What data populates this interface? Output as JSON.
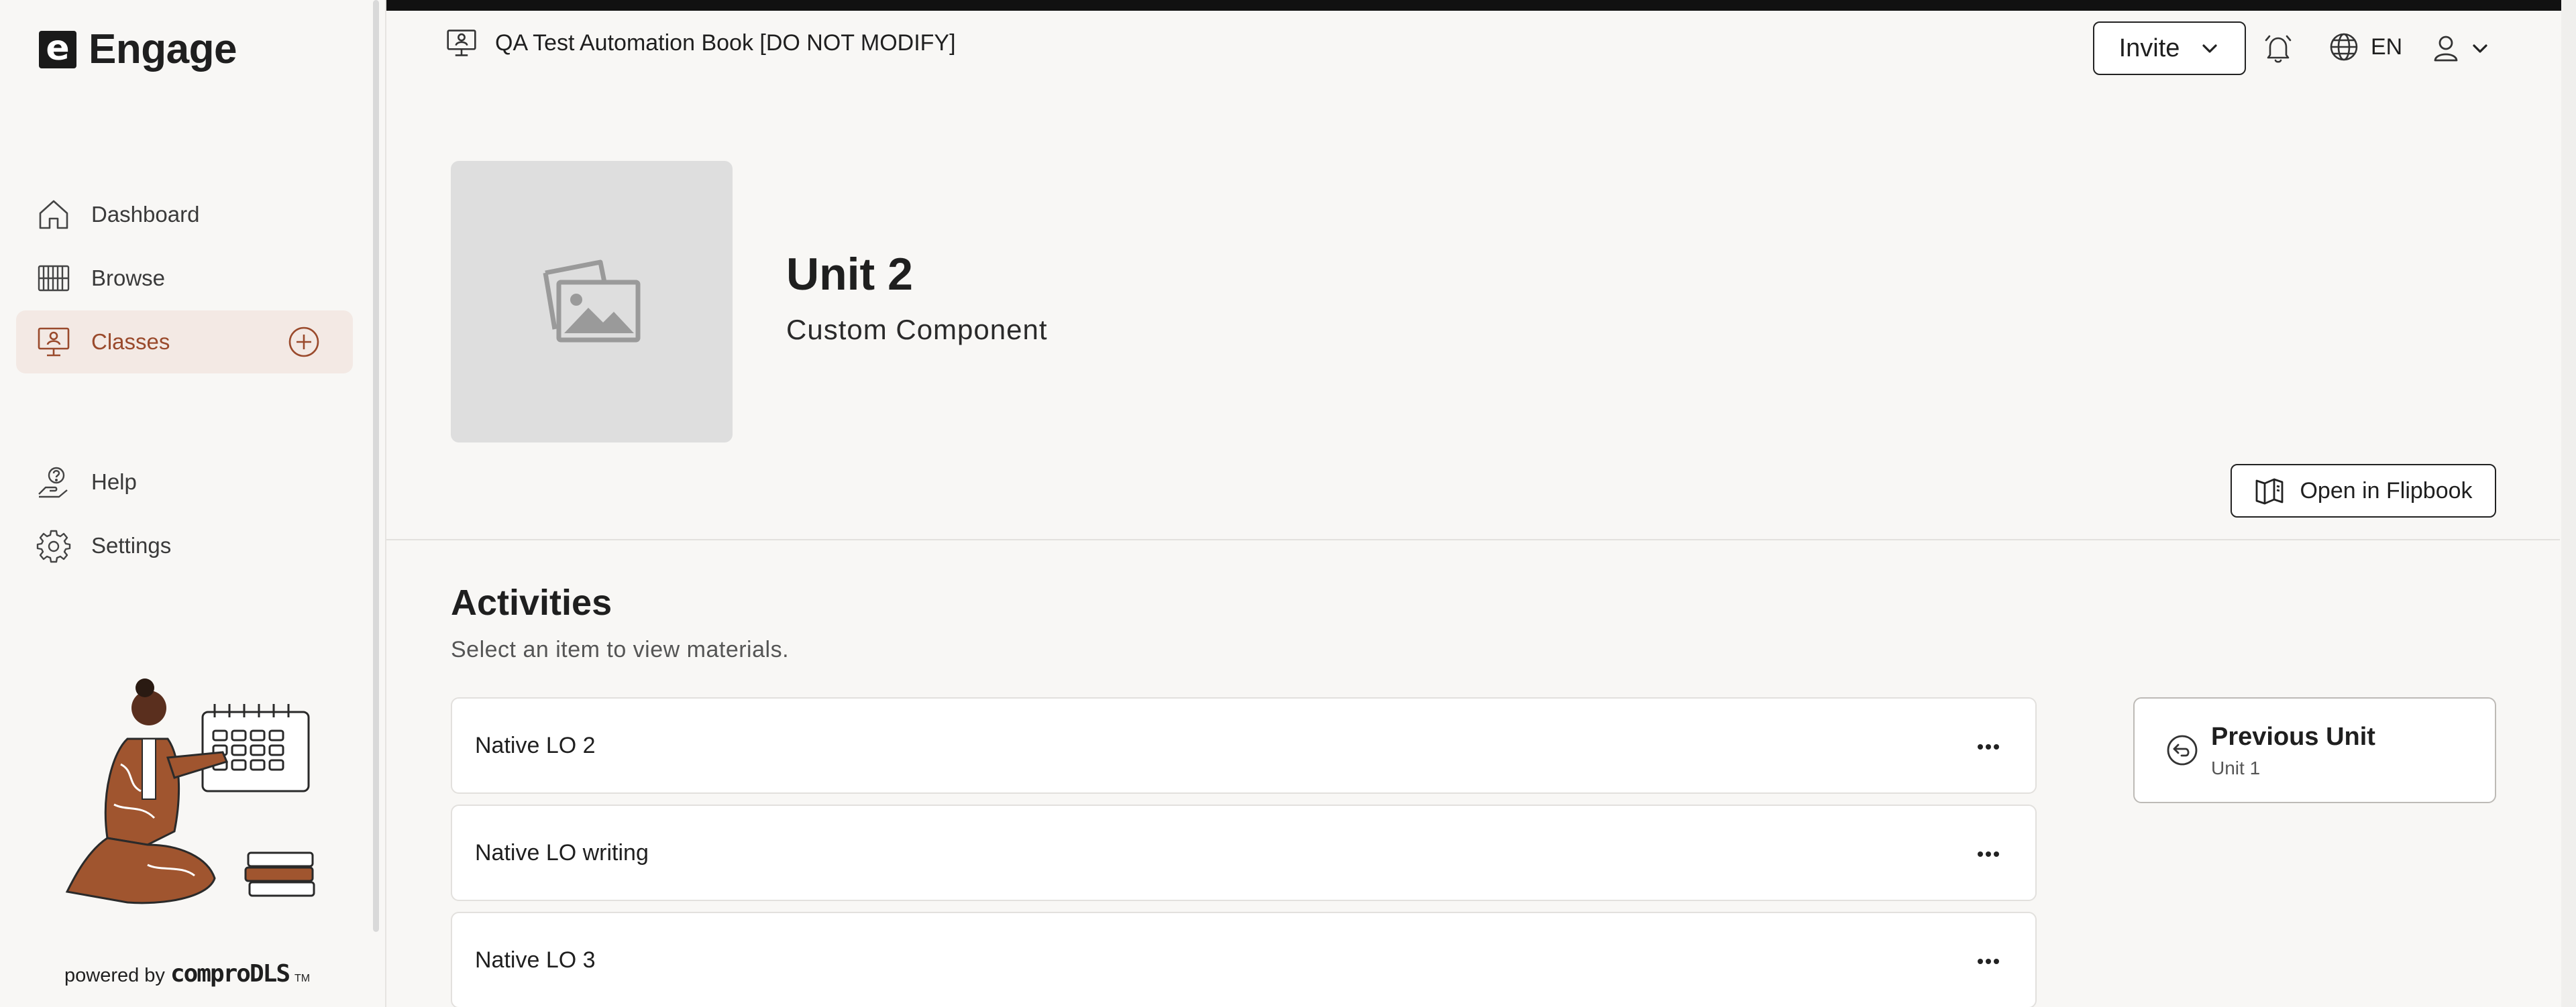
{
  "app": {
    "name": "Engage",
    "logo_letter": "e"
  },
  "sidebar": {
    "items": [
      {
        "label": "Dashboard",
        "icon": "home-icon",
        "active": false
      },
      {
        "label": "Browse",
        "icon": "books-icon",
        "active": false
      },
      {
        "label": "Classes",
        "icon": "classroom-icon",
        "active": true
      },
      {
        "label": "Help",
        "icon": "help-icon",
        "active": false
      },
      {
        "label": "Settings",
        "icon": "gear-icon",
        "active": false
      }
    ],
    "add_class_icon": "plus-circle-icon",
    "powered_by": "powered by",
    "powered_brand": "comproDLS",
    "powered_tm": "TM"
  },
  "header": {
    "class_name": "QA Test Automation Book [DO NOT MODIFY]",
    "invite_label": "Invite",
    "language": "EN"
  },
  "unit": {
    "title": "Unit 2",
    "subtitle": "Custom Component",
    "open_flipbook_label": "Open in Flipbook"
  },
  "activities": {
    "title": "Activities",
    "subtitle": "Select an item to view materials.",
    "items": [
      {
        "label": "Native LO 2"
      },
      {
        "label": "Native LO writing"
      },
      {
        "label": "Native LO 3"
      }
    ]
  },
  "previous_unit": {
    "label": "Previous Unit",
    "unit_name": "Unit 1"
  },
  "colors": {
    "accent": "#9a4a2c",
    "active_bg": "#f3e9e4",
    "page_bg": "#f8f7f5"
  }
}
